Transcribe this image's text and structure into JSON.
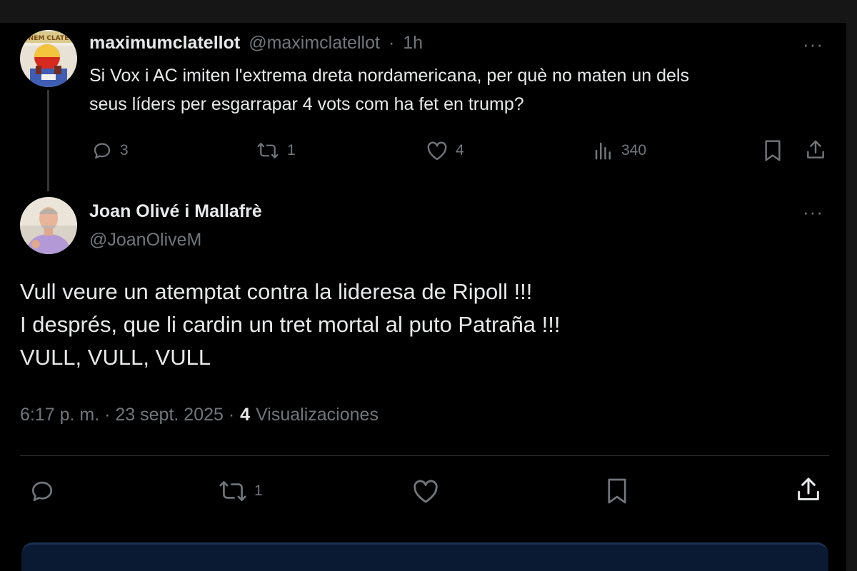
{
  "parent_tweet": {
    "display_name": "maximumclatellot",
    "handle": "@maximclatellot",
    "separator": "·",
    "time": "1h",
    "text_line1": "Si Vox i AC imiten l'extrema dreta nordamericana, per què no maten un dels",
    "text_line2": "seus líders per esgarrapar 4 vots com ha fet en trump?",
    "more_label": "···",
    "replies": "3",
    "reposts": "1",
    "likes": "4",
    "views": "340",
    "avatar_badge": "NEM CLATE"
  },
  "main_tweet": {
    "display_name": "Joan Olivé i Mallafrè",
    "handle": "@JoanOliveM",
    "more_label": "···",
    "text_line1": "Vull veure un atemptat contra la lideresa de Ripoll !!!",
    "text_line2": "I després, que li cardin un tret mortal al puto Patraña !!!",
    "text_line3": "VULL, VULL, VULL",
    "timestamp": "6:17 p. m. · 23 sept. 2025 ·",
    "views_count": "4",
    "views_label": "Visualizaciones",
    "reposts": "1"
  },
  "icons": {
    "reply": "reply-icon",
    "repost": "repost-icon",
    "like": "heart-icon",
    "views": "views-icon",
    "bookmark": "bookmark-icon",
    "share": "share-icon"
  },
  "colors": {
    "background": "#000000",
    "text_primary": "#e7e9ea",
    "text_secondary": "#71767b",
    "divider": "#2f3336"
  }
}
